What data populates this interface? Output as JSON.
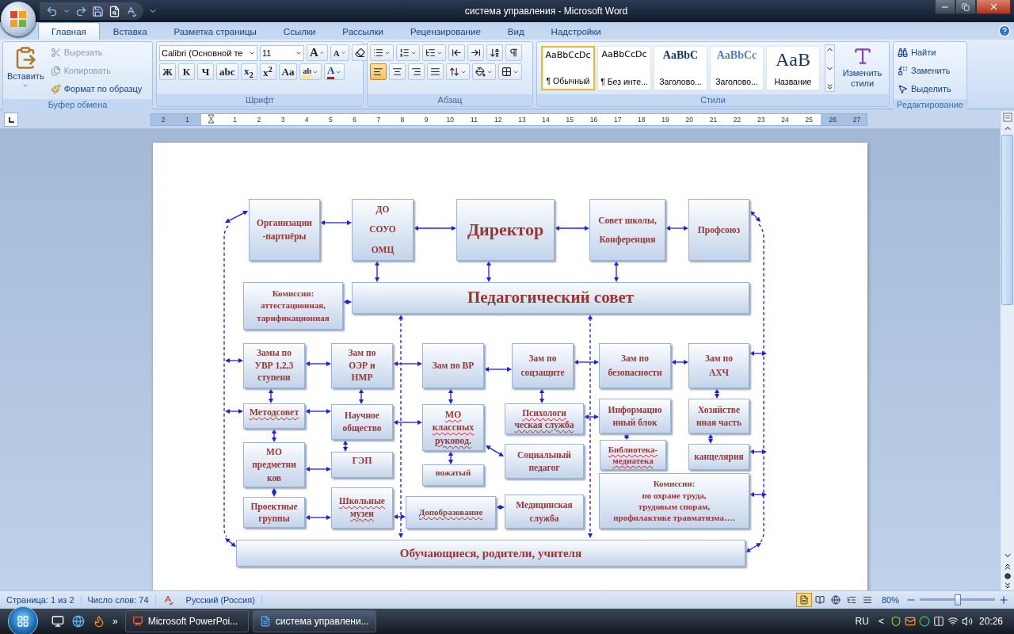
{
  "title_bar": {
    "title": "система управления - Microsoft Word"
  },
  "tabs": [
    {
      "label": "Главная",
      "selected": true
    },
    {
      "label": "Вставка",
      "selected": false
    },
    {
      "label": "Разметка страницы",
      "selected": false
    },
    {
      "label": "Ссылки",
      "selected": false
    },
    {
      "label": "Рассылки",
      "selected": false
    },
    {
      "label": "Рецензирование",
      "selected": false
    },
    {
      "label": "Вид",
      "selected": false
    },
    {
      "label": "Надстройки",
      "selected": false
    }
  ],
  "ribbon": {
    "clipboard": {
      "paste": "Вставить",
      "cut": {
        "label": "Вырезать",
        "disabled": true
      },
      "copy": {
        "label": "Копировать",
        "disabled": true
      },
      "format_painter": {
        "label": "Формат по образцу",
        "disabled": false
      },
      "group_label": "Буфер обмена"
    },
    "font": {
      "font_name": "Calibri (Основной те",
      "font_size": "11",
      "grow": "A",
      "shrink": "A",
      "format_buttons": [
        "Ж",
        "К",
        "Ч",
        "abc",
        "x$_{2}$",
        "x$^{2}$",
        "Aa"
      ],
      "highlight": "ab",
      "font_color": "A",
      "group_label": "Шрифт"
    },
    "paragraph": {
      "alignments": [
        {
          "kind": "left",
          "selected": true
        },
        {
          "kind": "center",
          "selected": false
        },
        {
          "kind": "right",
          "selected": false
        },
        {
          "kind": "justify",
          "selected": false
        }
      ],
      "group_label": "Абзац"
    },
    "styles": {
      "items": [
        {
          "sample": "AaBbCcDc",
          "name": "¶ Обычный",
          "kind": "normal",
          "selected": true
        },
        {
          "sample": "AaBbCcDc",
          "name": "¶ Без инте...",
          "kind": "normal",
          "selected": false
        },
        {
          "sample": "AaBbC",
          "name": "Заголово...",
          "kind": "heading1",
          "selected": false
        },
        {
          "sample": "AaBbCc",
          "name": "Заголово...",
          "kind": "heading2",
          "selected": false
        },
        {
          "sample": "AaB",
          "name": "Название",
          "kind": "title",
          "selected": false
        }
      ],
      "change_styles": "Изменить стили",
      "group_label": "Стили"
    },
    "editing": {
      "find": "Найти",
      "replace": "Заменить",
      "select": "Выделить",
      "group_label": "Редактирование"
    }
  },
  "ruler": {
    "marks": [
      "2",
      "1",
      "1",
      "2",
      "3",
      "4",
      "5",
      "6",
      "7",
      "8",
      "9",
      "10",
      "11",
      "12",
      "13",
      "14",
      "15",
      "16",
      "17",
      "18",
      "19",
      "20",
      "21",
      "22",
      "23",
      "24",
      "25",
      "26",
      "27"
    ]
  },
  "diagram": {
    "nodes": [
      {
        "lines": [
          "Организации",
          "-партнёры"
        ],
        "misspelled": false
      },
      {
        "lines": [
          "ДО",
          "СОУО",
          "ОМЦ"
        ],
        "misspelled": false
      },
      {
        "lines": [
          "Директор"
        ],
        "misspelled": false
      },
      {
        "lines": [
          "Совет школы,",
          "Конференция"
        ],
        "misspelled": false
      },
      {
        "lines": [
          "Профсоюз"
        ],
        "misspelled": false
      },
      {
        "lines": [
          "Комиссии:",
          "аттестационная,",
          "тарификационная"
        ],
        "misspelled": false
      },
      {
        "lines": [
          "Педагогический совет"
        ],
        "misspelled": false
      },
      {
        "lines": [
          "Замы по",
          "УВР 1,2,3",
          "ступени"
        ],
        "misspelled": false
      },
      {
        "lines": [
          "Зам по",
          "ОЭР  и",
          "НМР"
        ],
        "misspelled": false
      },
      {
        "lines": [
          "Зам по ВР"
        ],
        "misspelled": false
      },
      {
        "lines": [
          "Зам по",
          "соцзащите"
        ],
        "misspelled": false
      },
      {
        "lines": [
          "Зам по",
          "безопасности"
        ],
        "misspelled": false
      },
      {
        "lines": [
          "Зам по",
          "АХЧ"
        ],
        "misspelled": false
      },
      {
        "lines": [
          "Методсовет"
        ],
        "misspelled": true
      },
      {
        "lines": [
          "Научное",
          "общество"
        ],
        "misspelled": false
      },
      {
        "lines": [
          "МО",
          "классных",
          "руковод."
        ],
        "misspelled": true
      },
      {
        "lines": [
          "Психологи",
          "ческая служба"
        ],
        "misspelled": true
      },
      {
        "lines": [
          "Информацио",
          "нный блок"
        ],
        "misspelled": false
      },
      {
        "lines": [
          "Хозяйстве",
          "нная часть"
        ],
        "misspelled": false
      },
      {
        "lines": [
          "МО",
          "предметни",
          "ков"
        ],
        "misspelled": false
      },
      {
        "lines": [
          "ГЭП"
        ],
        "misspelled": false
      },
      {
        "lines": [
          "вожатый"
        ],
        "misspelled": false
      },
      {
        "lines": [
          "Социальный",
          "педагог"
        ],
        "misspelled": false
      },
      {
        "lines": [
          "Библиотека-",
          "медиатека"
        ],
        "misspelled": true
      },
      {
        "lines": [
          "канцелярия"
        ],
        "misspelled": false
      },
      {
        "lines": [
          "Проектные",
          "группы"
        ],
        "misspelled": false
      },
      {
        "lines": [
          "Школьные",
          "музеи"
        ],
        "misspelled": true
      },
      {
        "lines": [
          "Допобразование"
        ],
        "misspelled": true
      },
      {
        "lines": [
          "Медицинская",
          "служба"
        ],
        "misspelled": false
      },
      {
        "lines": [
          "Комиссии:",
          "по охране труда,",
          "трудовым спорам,",
          "профилактике  травматизма…."
        ],
        "misspelled": false
      },
      {
        "lines": [
          "Обучающиеся, родители, учителя"
        ],
        "misspelled": false
      }
    ]
  },
  "status_bar": {
    "page": "Страница: 1 из 2",
    "words": "Число слов: 74",
    "language": "Русский (Россия)",
    "views": [
      {
        "selected": true
      },
      {
        "selected": false
      },
      {
        "selected": false
      },
      {
        "selected": false
      },
      {
        "selected": false
      }
    ],
    "zoom": "80%",
    "zoom_slider": {
      "level": 0.5
    }
  },
  "taskbar": {
    "more": "»",
    "tasks": [
      {
        "label": "Microsoft PowerPoi...",
        "kind": "powerpoint",
        "selected": false
      },
      {
        "label": "система управлени...",
        "kind": "word",
        "selected": true
      }
    ],
    "language": "RU",
    "tray_more": "<",
    "clock": "20:26"
  }
}
